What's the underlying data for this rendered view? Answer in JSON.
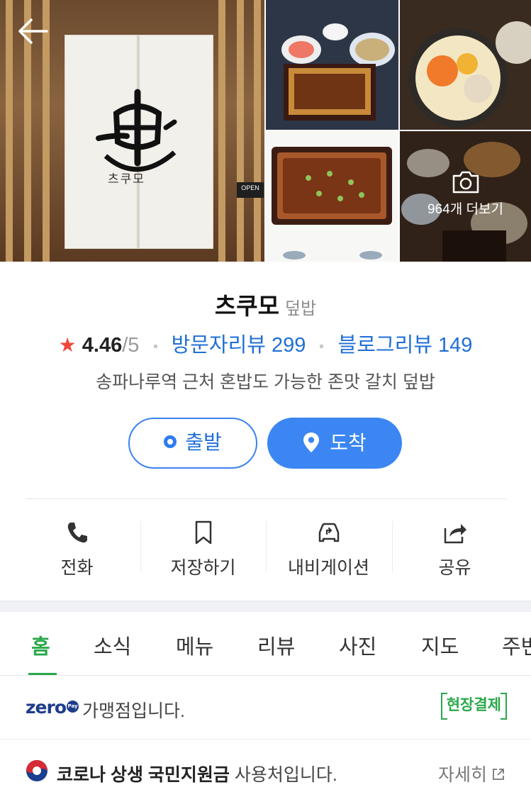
{
  "header": {
    "back_label": "뒤로",
    "main_photo": {
      "noren_text": "츠쿠모",
      "open_sign": "OPEN"
    },
    "more_photos_label": "964개 더보기"
  },
  "place": {
    "name": "츠쿠모",
    "category": "덮밥",
    "rating": {
      "star": "★",
      "value": "4.46",
      "max": "/5"
    },
    "visitor_reviews": "방문자리뷰 299",
    "blog_reviews": "블로그리뷰 149",
    "description": "송파나루역 근처 혼밥도 가능한 존맛 갈치 덮밥"
  },
  "route": {
    "start_label": "출발",
    "arrive_label": "도착"
  },
  "actions": [
    {
      "icon": "phone-icon",
      "label": "전화"
    },
    {
      "icon": "bookmark-icon",
      "label": "저장하기"
    },
    {
      "icon": "car-navigation-icon",
      "label": "내비게이션"
    },
    {
      "icon": "share-icon",
      "label": "공유"
    }
  ],
  "tabs": [
    {
      "label": "홈",
      "active": true
    },
    {
      "label": "소식"
    },
    {
      "label": "메뉴"
    },
    {
      "label": "리뷰"
    },
    {
      "label": "사진"
    },
    {
      "label": "지도"
    },
    {
      "label": "주변"
    }
  ],
  "notices": {
    "zeropay": {
      "logo": "zero",
      "logo_pay": "Pay",
      "text": "가맹점입니다.",
      "tag": "현장결제"
    },
    "covid": {
      "bold": "코로나 상생 국민지원금",
      "text": " 사용처입니다.",
      "link": "자세히"
    }
  },
  "colors": {
    "accent_blue": "#3b86f2",
    "link_blue": "#1f6fd6",
    "green": "#2aa84a",
    "star_red": "#f0473a"
  }
}
